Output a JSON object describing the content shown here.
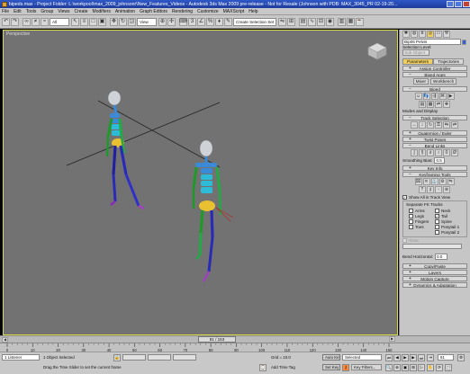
{
  "window": {
    "title": "bipeds.max  -  Project Folder: L:\\workpool\\max_2009_johnsonr\\New_Features_Videos  -  Autodesk 3ds Max  2009 pre-release  - Not for Resale (Johnson with PDB: MAX_3045_PR 02-19-20..."
  },
  "menu": [
    "File",
    "Edit",
    "Tools",
    "Group",
    "Views",
    "Create",
    "Modifiers",
    "Animation",
    "Graph Editors",
    "Rendering",
    "Customize",
    "MAXScript",
    "Help"
  ],
  "toolbar": {
    "filter_value": "All",
    "refcoord_value": "View",
    "selection_set_placeholder": "Create Selection Set"
  },
  "viewport": {
    "label": "Perspective"
  },
  "command_panel": {
    "object_name": "Bip06 Pelvis",
    "selection_level_label": "Selection Level:",
    "sub_object_value": "Sub-Object",
    "tabs": [
      "Parameters",
      "Trajectories"
    ],
    "rollouts": {
      "assign_controller": "Assign Controller",
      "biped_apps": "Biped Apps",
      "biped": "Biped",
      "track_selection": "Track Selection",
      "quaternion_euler": "Quaternion / Euler",
      "twist_poses": "Twist Poses",
      "bend_links": "Bend Links",
      "key_info": "Key Info",
      "keyframing_tools": "Keyframing Tools",
      "copy_paste": "Copy/Paste",
      "layers": "Layers",
      "motion_capture": "Motion Capture",
      "dynamics": "Dynamics & Adaptation"
    },
    "biped_apps_buttons": [
      "Mixer",
      "Workbench"
    ],
    "modes_and_display": "Modes and Display",
    "smoothing_bias_label": "Smoothing Bias:",
    "smoothing_bias_value": "0.5",
    "show_all_label": "Show All in Track View",
    "separate_fk_label": "Separate FK Tracks",
    "fk_tracks": [
      {
        "label": "Arms",
        "checked": false
      },
      {
        "label": "Neck",
        "checked": false
      },
      {
        "label": "Legs",
        "checked": false
      },
      {
        "label": "Tail",
        "checked": true
      },
      {
        "label": "Fingers",
        "checked": false
      },
      {
        "label": "Spine",
        "checked": false
      },
      {
        "label": "Toes",
        "checked": false
      },
      {
        "label": "Ponytail 1",
        "checked": false
      },
      {
        "label": "",
        "checked": false
      },
      {
        "label": "Ponytail 2",
        "checked": false
      }
    ],
    "xtras_label": "Xtras",
    "bend_horizontal_label": "Bend Horizontal:",
    "bend_horizontal_value": "0.0"
  },
  "timeslider": {
    "frame": "81 / 153"
  },
  "track_ticks": [
    "0",
    "10",
    "20",
    "30",
    "40",
    "50",
    "60",
    "70",
    "80",
    "90",
    "100",
    "110",
    "120",
    "130",
    "140",
    "150"
  ],
  "status": {
    "maxscript_label": "1 Listener",
    "selected_text": "1 Object Selected",
    "prompt_text": "Drag the Time Slider to set the current frame",
    "grid_text": "Grid = 10.0",
    "add_time_tag": "Add Time Tag",
    "auto_key": "Auto Key",
    "set_key": "Set Key",
    "key_mode_value": "Selected",
    "key_filters": "Key Filters...",
    "frame_field": "81"
  },
  "colors": {
    "title_blue": "#2f58c8",
    "viewport_bg": "#727272",
    "active_border": "#dada4a",
    "tab_active": "#f0d060"
  }
}
